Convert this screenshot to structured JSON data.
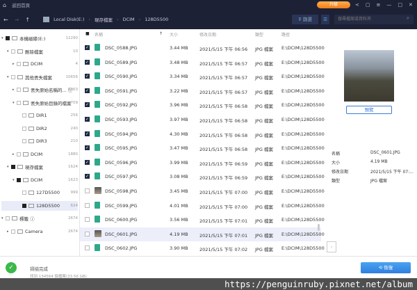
{
  "titlebar": {
    "title": "返回首頁",
    "upgrade": "升級"
  },
  "nav": {
    "crumbs": [
      "Local Disk(E:)",
      "現存檔案",
      "DCIM",
      "128D5500"
    ],
    "filter": "篩選",
    "search_placeholder": "搜尋檔案或資料夾"
  },
  "tree": [
    {
      "label": "本機磁碟(E:)",
      "count": "12290",
      "level": 0,
      "tri": "▾",
      "state": "full"
    },
    {
      "label": "刪除檔案",
      "count": "10",
      "level": 1,
      "tri": "▾",
      "state": "empty"
    },
    {
      "label": "DCIM",
      "count": "4",
      "level": 2,
      "tri": "▸",
      "state": "empty"
    },
    {
      "label": "其他丟失檔案",
      "count": "10656",
      "level": 1,
      "tri": "▾",
      "state": "empty"
    },
    {
      "label": "丟失原始名稱的... ⓘ",
      "count": "6063",
      "level": 2,
      "tri": "▸",
      "state": "empty"
    },
    {
      "label": "丟失原始目錄的檔案",
      "count": "709",
      "level": 2,
      "tri": "▾",
      "state": "empty"
    },
    {
      "label": "DIR1",
      "count": "256",
      "level": 3,
      "tri": "",
      "state": "empty"
    },
    {
      "label": "DIR2",
      "count": "240",
      "level": 3,
      "tri": "",
      "state": "empty"
    },
    {
      "label": "DIR3",
      "count": "210",
      "level": 3,
      "tri": "",
      "state": "empty"
    },
    {
      "label": "DCIM",
      "count": "1880",
      "level": 2,
      "tri": "▸",
      "state": "empty"
    },
    {
      "label": "現存檔案",
      "count": "1624",
      "level": 1,
      "tri": "▾",
      "state": "full"
    },
    {
      "label": "DCIM",
      "count": "1623",
      "level": 2,
      "tri": "▾",
      "state": "full"
    },
    {
      "label": "127D5500",
      "count": "999",
      "level": 3,
      "tri": "",
      "state": "empty"
    },
    {
      "label": "128D5500",
      "count": "624",
      "level": 3,
      "tri": "",
      "state": "full",
      "selected": true
    },
    {
      "label": "標籤 ⓘ",
      "count": "2674",
      "level": 0,
      "tri": "▾",
      "state": "empty"
    },
    {
      "label": "Camera",
      "count": "2674",
      "level": 1,
      "tri": "▸",
      "state": "empty"
    }
  ],
  "columns": {
    "name": "名稱",
    "size": "大小",
    "date": "修改日期",
    "type": "類型",
    "path": "路徑"
  },
  "files": [
    {
      "name": "DSC_0588.JPG",
      "size": "3.44 MB",
      "date": "2021/5/15 下午 06:56",
      "checked": true
    },
    {
      "name": "DSC_0589.JPG",
      "size": "3.48 MB",
      "date": "2021/5/15 下午 06:57",
      "checked": true
    },
    {
      "name": "DSC_0590.JPG",
      "size": "3.34 MB",
      "date": "2021/5/15 下午 06:57",
      "checked": true
    },
    {
      "name": "DSC_0591.JPG",
      "size": "3.22 MB",
      "date": "2021/5/15 下午 06:57",
      "checked": true
    },
    {
      "name": "DSC_0592.JPG",
      "size": "3.96 MB",
      "date": "2021/5/15 下午 06:58",
      "checked": true
    },
    {
      "name": "DSC_0593.JPG",
      "size": "3.97 MB",
      "date": "2021/5/15 下午 06:58",
      "checked": true
    },
    {
      "name": "DSC_0594.JPG",
      "size": "4.30 MB",
      "date": "2021/5/15 下午 06:58",
      "checked": true
    },
    {
      "name": "DSC_0595.JPG",
      "size": "3.47 MB",
      "date": "2021/5/15 下午 06:58",
      "checked": true
    },
    {
      "name": "DSC_0596.JPG",
      "size": "3.99 MB",
      "date": "2021/5/15 下午 06:59",
      "checked": true
    },
    {
      "name": "DSC_0597.JPG",
      "size": "3.08 MB",
      "date": "2021/5/15 下午 06:59",
      "checked": true
    },
    {
      "name": "DSC_0598.JPG",
      "size": "3.45 MB",
      "date": "2021/5/15 下午 07:00",
      "checked": false,
      "photo": true
    },
    {
      "name": "DSC_0599.JPG",
      "size": "4.01 MB",
      "date": "2021/5/15 下午 07:00",
      "checked": false
    },
    {
      "name": "DSC_0600.JPG",
      "size": "3.56 MB",
      "date": "2021/5/15 下午 07:01",
      "checked": false
    },
    {
      "name": "DSC_0601.JPG",
      "size": "4.19 MB",
      "date": "2021/5/15 下午 07:01",
      "checked": false,
      "photo": true,
      "highlight": true
    },
    {
      "name": "DSC_0602.JPG",
      "size": "3.90 MB",
      "date": "2021/5/15 下午 07:02",
      "checked": false
    }
  ],
  "file_type": "JPG 檔案",
  "file_path": "E:\\DCIM\\128D5500",
  "preview": {
    "button": "預覽",
    "info": [
      {
        "k": "名稱",
        "v": "DSC_0601.JPG"
      },
      {
        "k": "大小",
        "v": "4.19 MB"
      },
      {
        "k": "修改日期",
        "v": "2021/5/15 下午 07:..."
      },
      {
        "k": "類型",
        "v": "JPG 檔案"
      }
    ]
  },
  "bottom": {
    "status": "掃描完成",
    "found": "找到 134564 個檔案(33.56 GB)",
    "recover": "恢復"
  },
  "watermark": "https://penguinruby.pixnet.net/album"
}
